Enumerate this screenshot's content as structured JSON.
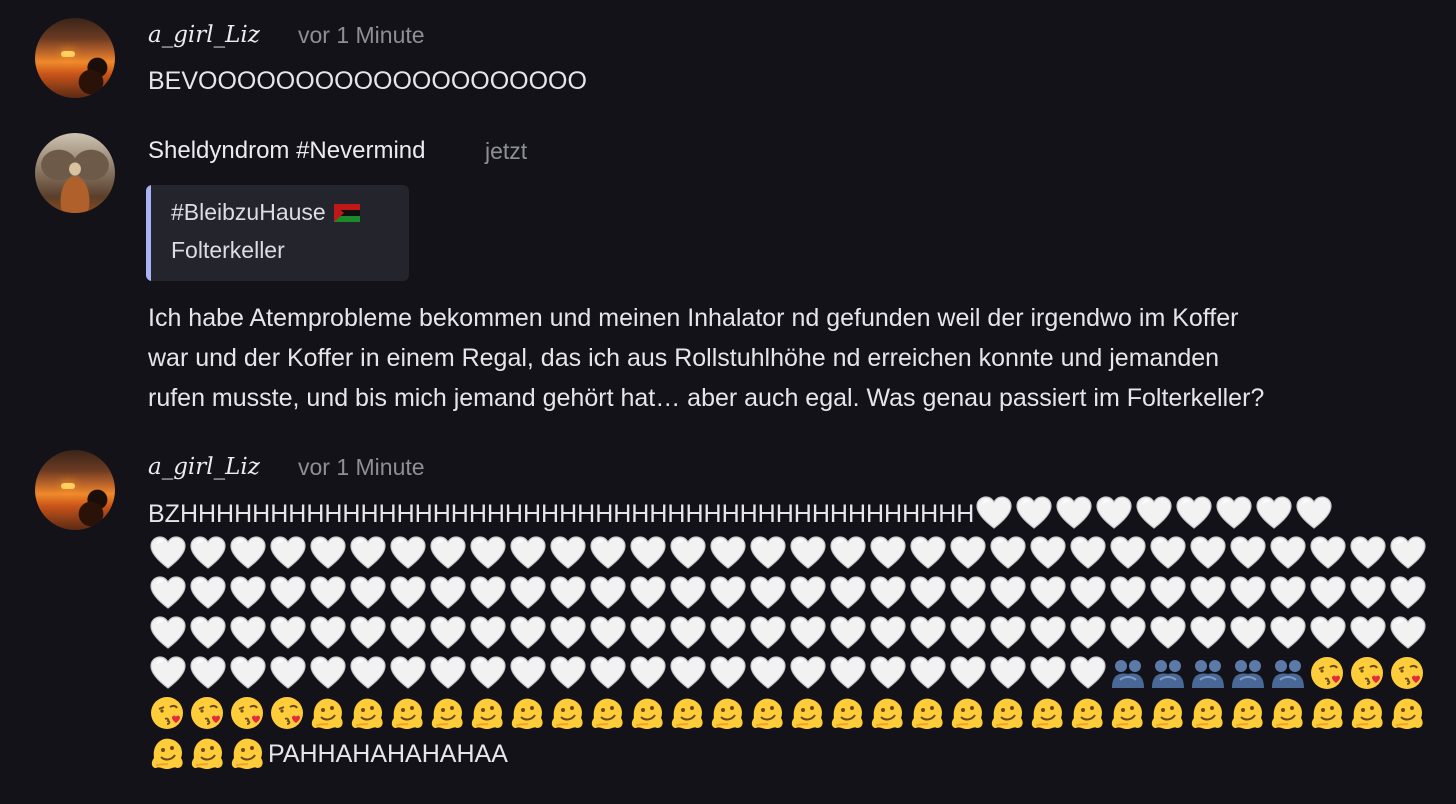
{
  "messages": [
    {
      "author": "a_girl_Liz",
      "time": "vor 1 Minute",
      "text": "BEVOOOOOOOOOOOOOOOOOOOO"
    },
    {
      "author": "Sheldyndrom #Nevermind",
      "time": "jetzt",
      "reply": {
        "channel": "#BleibzuHause",
        "flag_icon": "flag-icon",
        "title": "Folterkeller"
      },
      "lines": [
        "Ich habe Atemprobleme bekommen und meinen Inhalator nd gefunden weil der irgendwo im Koffer",
        "war und der Koffer in einem Regal, das ich aus Rollstuhlhöhe nd erreichen konnte und jemanden",
        "rufen musste, und bis mich jemand gehört hat… aber auch egal. Was genau passiert im Folterkeller?"
      ]
    },
    {
      "author": "a_girl_Liz",
      "time": "vor 1 Minute",
      "text_start": "BZHHHHHHHHHHHHHHHHHHHHHHHHHHHHHHHHHHHHHHHHHHHH",
      "text_end": "PAHHAHAHAHAHAA",
      "emoji": {
        "white_heart": "🤍",
        "couple_silhouette": "🫂",
        "face_blowing_kiss": "😘",
        "melting_face": "🫠"
      }
    }
  ],
  "colors": {
    "background": "#121218",
    "quote_bar": "#a9b4f5",
    "muted": "#8e8e96"
  }
}
